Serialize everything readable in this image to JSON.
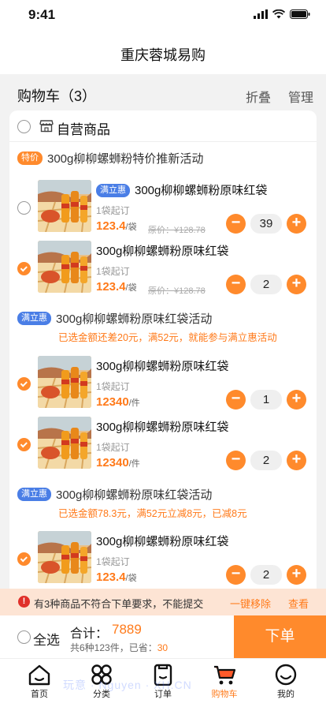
{
  "status": {
    "time": "9:41"
  },
  "nav": {
    "title": "重庆蓉城易购"
  },
  "cart": {
    "title": "购物车（3）",
    "fold": "折叠",
    "manage": "管理"
  },
  "store": {
    "name": "自营商品"
  },
  "groups": [
    {
      "badge": "特价",
      "title": "300g柳柳螺蛳粉特价推新活动",
      "note": "",
      "items": [
        {
          "badge": "满立惠",
          "name": "300g柳柳螺蛳粉原味红袋",
          "min": "1袋起订",
          "price": "123.4",
          "unit": "/袋",
          "orig": "原价：¥128.78",
          "qty": "39",
          "checked": false
        },
        {
          "badge": "",
          "name": "300g柳柳螺蛳粉原味红袋",
          "min": "1袋起订",
          "price": "123.4",
          "unit": "/袋",
          "orig": "原价：¥128.78",
          "qty": "2",
          "checked": true
        }
      ]
    },
    {
      "badge": "满立惠",
      "title": "300g柳柳螺蛳粉原味红袋活动",
      "note": "已选金额还差20元，满52元，就能参与满立惠活动",
      "items": [
        {
          "badge": "",
          "name": "300g柳柳螺蛳粉原味红袋",
          "min": "1袋起订",
          "price": "12340",
          "unit": "/件",
          "orig": "",
          "qty": "1",
          "checked": true
        },
        {
          "badge": "",
          "name": "300g柳柳螺蛳粉原味红袋",
          "min": "1袋起订",
          "price": "12340",
          "unit": "/件",
          "orig": "",
          "qty": "2",
          "checked": true
        }
      ]
    },
    {
      "badge": "满立惠",
      "title": "300g柳柳螺蛳粉原味红袋活动",
      "note": "已选金额78.3元，满52元立减8元，已减8元",
      "items": [
        {
          "badge": "",
          "name": "300g柳柳螺蛳粉原味红袋",
          "min": "1袋起订",
          "price": "123.4",
          "unit": "/袋",
          "orig": "",
          "qty": "2",
          "checked": true
        }
      ]
    }
  ],
  "warning": {
    "icon": "!",
    "text": "有3种商品不符合下单要求，不能提交",
    "remove": "一键移除",
    "view": "查看"
  },
  "checkout": {
    "select_all": "全选",
    "total_label": "合计：",
    "total": "7889",
    "summary": "共6种123件，已省：",
    "saved": "30",
    "submit": "下单"
  },
  "tabs": [
    {
      "label": "首页",
      "icon": "home-icon"
    },
    {
      "label": "分类",
      "icon": "category-icon"
    },
    {
      "label": "订单",
      "icon": "order-icon"
    },
    {
      "label": "购物车",
      "icon": "cart-icon"
    },
    {
      "label": "我的",
      "icon": "profile-icon"
    }
  ],
  "watermark": "玩意 · Nguyen · XH.CN",
  "colors": {
    "accent": "#ff8a2c",
    "badge_blue": "#4a7ee6",
    "warning_bg": "#fde4d4"
  }
}
